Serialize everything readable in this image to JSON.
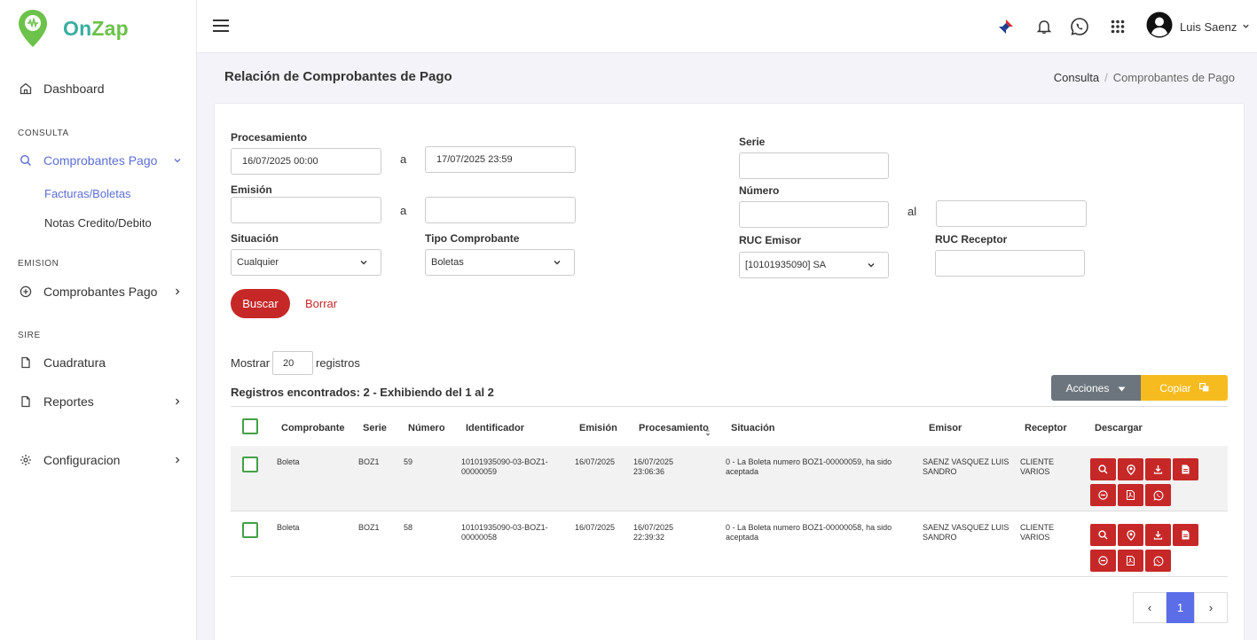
{
  "app": {
    "logo_on": "On",
    "logo_zap": "Zap"
  },
  "sidebar": {
    "dashboard": "Dashboard",
    "section_consulta": "CONSULTA",
    "consulta_comprobantes": "Comprobantes Pago",
    "sub_facturas": "Facturas/Boletas",
    "sub_notas": "Notas Credito/Debito",
    "section_emision": "EMISION",
    "emision_comprobantes": "Comprobantes Pago",
    "section_sire": "SIRE",
    "cuadratura": "Cuadratura",
    "reportes": "Reportes",
    "configuracion": "Configuracion"
  },
  "topbar": {
    "user_name": "Luis Saenz"
  },
  "page": {
    "title": "Relación de Comprobantes de Pago",
    "breadcrumb": [
      "Consulta",
      "Comprobantes de Pago"
    ]
  },
  "filters": {
    "procesamiento_label": "Procesamiento",
    "procesamiento_from": "16/07/2025 00:00",
    "procesamiento_to": "17/07/2025 23:59",
    "a_label": "a",
    "emision_label": "Emisión",
    "emision_from": "",
    "emision_to": "",
    "situacion_label": "Situación",
    "situacion_value": "Cualquier",
    "tipo_label": "Tipo Comprobante",
    "tipo_value": "Boletas",
    "serie_label": "Serie",
    "serie_value": "",
    "numero_label": "Número",
    "numero_from": "",
    "al_label": "al",
    "numero_to": "",
    "ruc_emisor_label": "RUC Emisor",
    "ruc_emisor_value": "[10101935090] SA",
    "ruc_receptor_label": "RUC Receptor",
    "ruc_receptor_value": ""
  },
  "actions": {
    "buscar": "Buscar",
    "borrar": "Borrar"
  },
  "listing": {
    "mostrar": "Mostrar",
    "page_size": "20",
    "registros": "registros",
    "summary": "Registros encontrados: 2 - Exhibiendo del 1 al 2",
    "acciones": "Acciones",
    "copiar": "Copiar"
  },
  "table": {
    "columns": [
      "Comprobante",
      "Serie",
      "Número",
      "Identificador",
      "Emisión",
      "Procesamiento",
      "Situación",
      "Emisor",
      "Receptor",
      "Descargar"
    ],
    "rows": [
      {
        "comprobante": "Boleta",
        "serie": "BOZ1",
        "numero": "59",
        "identificador": "10101935090-03-BOZ1-00000059",
        "emision": "16/07/2025",
        "procesamiento": "16/07/2025 23:06:36",
        "situacion": "0 - La Boleta numero BOZ1-00000059, ha sido aceptada",
        "emisor": "SAENZ VASQUEZ LUIS SANDRO",
        "receptor": "CLIENTE VARIOS"
      },
      {
        "comprobante": "Boleta",
        "serie": "BOZ1",
        "numero": "58",
        "identificador": "10101935090-03-BOZ1-00000058",
        "emision": "16/07/2025",
        "procesamiento": "16/07/2025 22:39:32",
        "situacion": "0 - La Boleta numero BOZ1-00000058, ha sido aceptada",
        "emisor": "SAENZ VASQUEZ LUIS SANDRO",
        "receptor": "CLIENTE VARIOS"
      }
    ]
  },
  "pagination": {
    "prev": "‹",
    "current": "1",
    "next": "›"
  },
  "colors": {
    "accent": "#5b6ed6",
    "danger": "#c62828",
    "warning": "#f6bb1e",
    "success": "#43a047"
  }
}
